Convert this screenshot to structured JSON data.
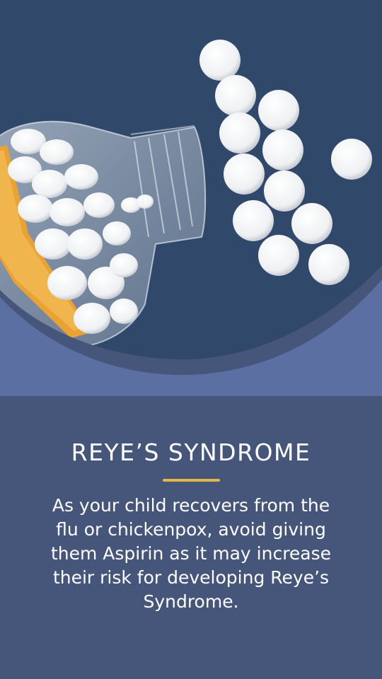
{
  "colors": {
    "background": "#46557a",
    "photo_background": "#2f4766",
    "arc_border": "#5b6fa3",
    "accent": "#e2b84a",
    "text": "#ffffff"
  },
  "graphic": {
    "icon": "aspirin-bottle-and-pills-image"
  },
  "card": {
    "title": "REYE’S SYNDROME",
    "body": "As your child recovers from the flu or chickenpox, avoid giving them Aspirin as it may increase their risk for developing Reye’s Syndrome."
  }
}
